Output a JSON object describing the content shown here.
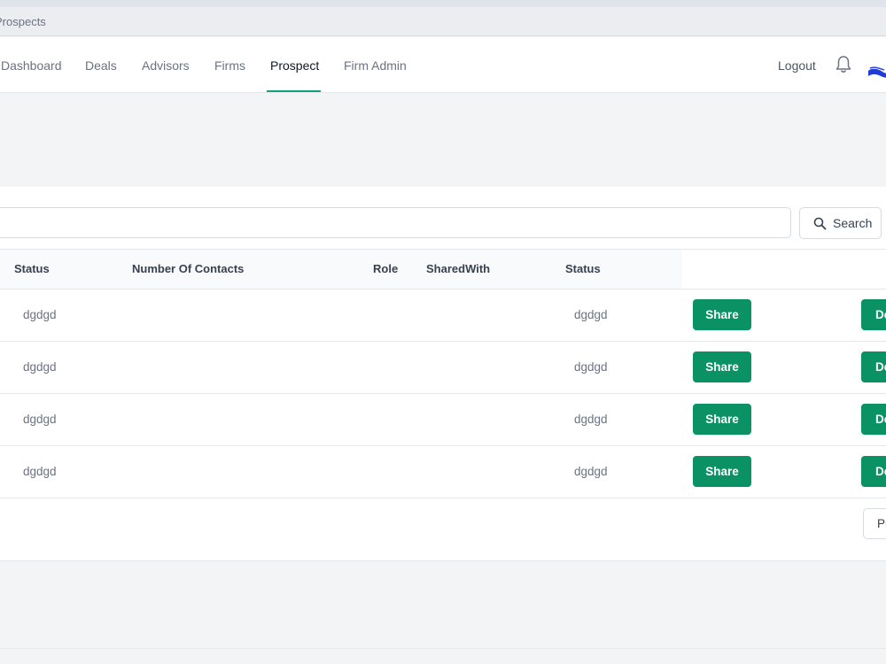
{
  "browser": {
    "tab_title": "Prospects"
  },
  "nav": {
    "items": [
      {
        "label": "Dashboard",
        "active": false
      },
      {
        "label": "Deals",
        "active": false
      },
      {
        "label": "Advisors",
        "active": false
      },
      {
        "label": "Firms",
        "active": false
      },
      {
        "label": "Prospect",
        "active": true
      },
      {
        "label": "Firm Admin",
        "active": false
      }
    ],
    "logout_label": "Logout",
    "icons": {
      "notifications": "bell-icon",
      "profile": "avatar"
    }
  },
  "search": {
    "button_label": "Search",
    "value": "",
    "icon": "search-icon"
  },
  "table": {
    "headers": [
      "Status",
      "Number Of Contacts",
      "Role",
      "SharedWith",
      "Status"
    ],
    "rows": [
      {
        "status": "dgdgd",
        "number_of_contacts": "",
        "role": "",
        "shared_with": "",
        "status2": "dgdgd",
        "share_label": "Share",
        "second_action_label": "De"
      },
      {
        "status": "dgdgd",
        "number_of_contacts": "",
        "role": "",
        "shared_with": "",
        "status2": "dgdgd",
        "share_label": "Share",
        "second_action_label": "De"
      },
      {
        "status": "dgdgd",
        "number_of_contacts": "",
        "role": "",
        "shared_with": "",
        "status2": "dgdgd",
        "share_label": "Share",
        "second_action_label": "De"
      },
      {
        "status": "dgdgd",
        "number_of_contacts": "",
        "role": "",
        "shared_with": "",
        "status2": "dgdgd",
        "share_label": "Share",
        "second_action_label": "De"
      }
    ]
  },
  "pagination": {
    "prev_label": "Pr"
  },
  "colors": {
    "accent": "#0a9164",
    "nav_underline": "#10a37f",
    "page_bg": "#f3f4f6"
  }
}
